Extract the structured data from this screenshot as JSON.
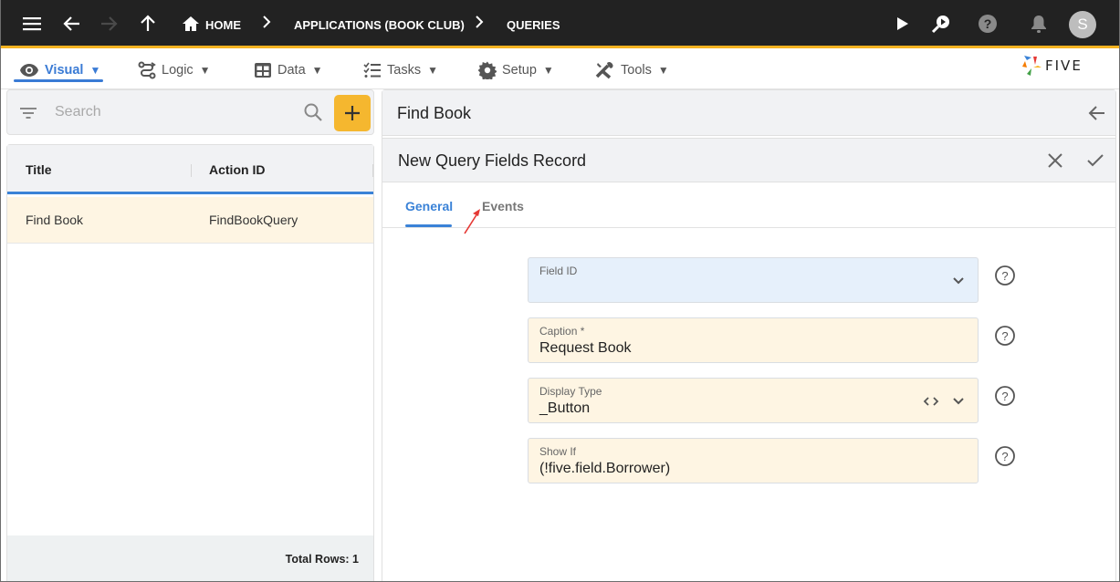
{
  "topbar": {
    "icons": [
      "menu-icon",
      "back-arrow-icon",
      "forward-arrow-icon",
      "up-arrow-icon"
    ],
    "breadcrumb": {
      "home": "HOME",
      "items": [
        "APPLICATIONS (BOOK CLUB)",
        "QUERIES"
      ],
      "separator": ">"
    },
    "right_icons": [
      "play-icon",
      "search-play-icon",
      "help-icon",
      "bell-icon"
    ],
    "avatar_initial": "S"
  },
  "menubar": {
    "items": [
      {
        "label": "Visual",
        "icon": "eye-icon",
        "active": true
      },
      {
        "label": "Logic",
        "icon": "logic-icon",
        "active": false
      },
      {
        "label": "Data",
        "icon": "table-icon",
        "active": false
      },
      {
        "label": "Tasks",
        "icon": "tasks-icon",
        "active": false
      },
      {
        "label": "Setup",
        "icon": "gear-icon",
        "active": false
      },
      {
        "label": "Tools",
        "icon": "tools-icon",
        "active": false
      }
    ],
    "caret": "▼",
    "logo_text": "FIVE"
  },
  "left_panel": {
    "search": {
      "placeholder": "Search",
      "value": ""
    },
    "add_label": "+",
    "columns": [
      "Title",
      "Action ID"
    ],
    "rows": [
      {
        "title": "Find Book",
        "action_id": "FindBookQuery"
      }
    ],
    "total_rows_label": "Total Rows: 1"
  },
  "right_panel": {
    "title": "Find Book",
    "form_title": "New Query Fields Record",
    "tabs": [
      {
        "label": "General",
        "active": true
      },
      {
        "label": "Events",
        "active": false
      }
    ],
    "fields": [
      {
        "label": "Field ID",
        "value": "",
        "type": "select"
      },
      {
        "label": "Caption *",
        "value": "Request Book",
        "type": "text"
      },
      {
        "label": "Display Type",
        "value": "_Button",
        "type": "select-code"
      },
      {
        "label": "Show If",
        "value": "(!five.field.Borrower)",
        "type": "text"
      }
    ]
  },
  "colors": {
    "accent": "#3a82d7",
    "topbar": "#222222",
    "topbar_border": "#f5b220",
    "add_button": "#f5b72f",
    "highlight_row": "#fef5e3",
    "field_bg": "#fef5e3",
    "select_field_bg": "#e6f0fb",
    "annotation_arrow": "#e53935"
  }
}
